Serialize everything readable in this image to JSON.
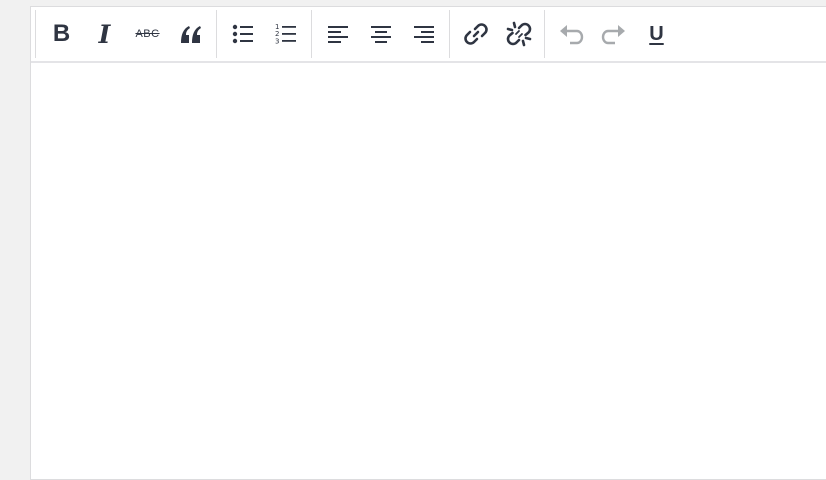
{
  "toolbar": {
    "bold_label": "B",
    "italic_label": "I",
    "strikethrough_label": "ABC",
    "underline_label": "U"
  },
  "colors": {
    "icon": "#2f3542",
    "icon_disabled": "#a7aaad",
    "border": "#dcdcde",
    "page_bg": "#f1f1f1"
  },
  "icons": [
    "bold-icon",
    "italic-icon",
    "strikethrough-icon",
    "blockquote-icon",
    "bullet-list-icon",
    "numbered-list-icon",
    "align-left-icon",
    "align-center-icon",
    "align-right-icon",
    "link-icon",
    "unlink-icon",
    "undo-icon",
    "redo-icon",
    "underline-icon"
  ]
}
